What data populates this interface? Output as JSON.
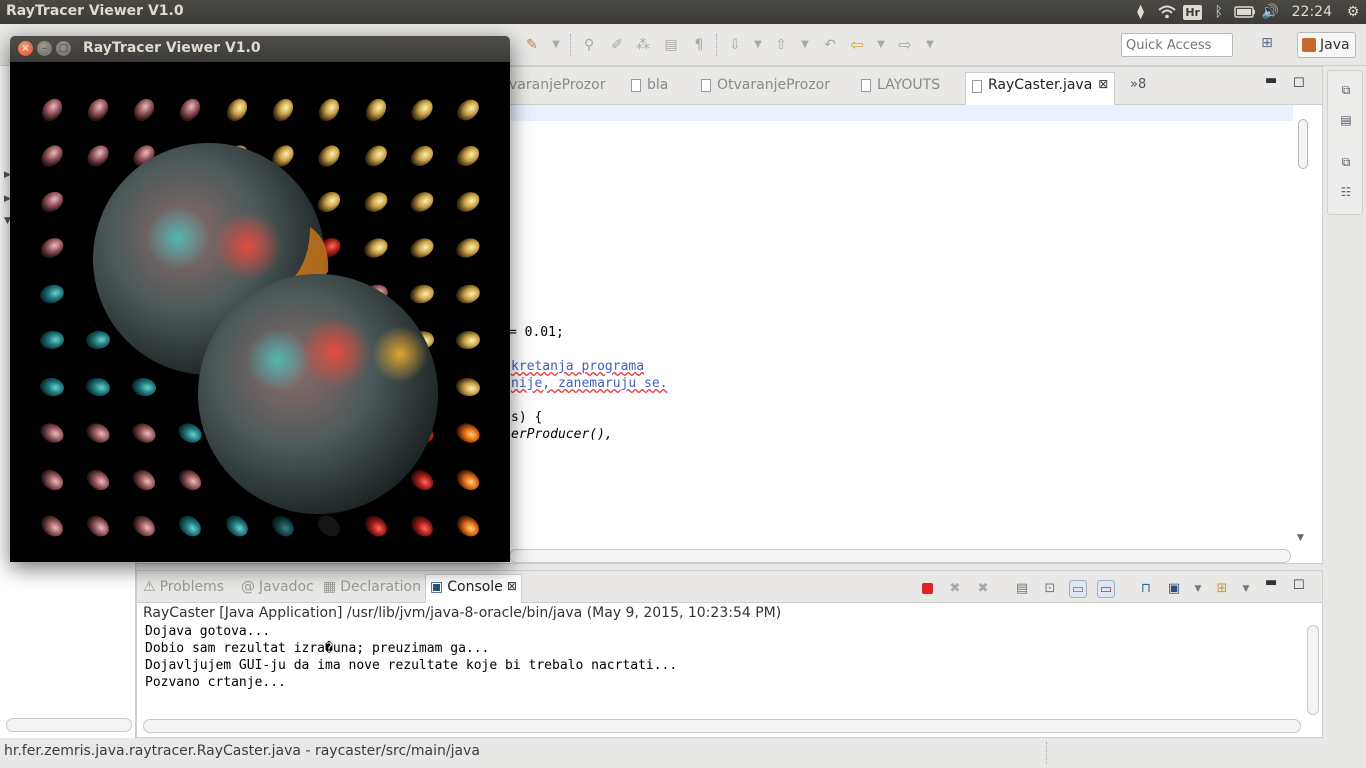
{
  "panel": {
    "app_title": "RayTracer Viewer V1.0",
    "keyboard_layout": "Hr",
    "clock": "22:24",
    "tray_icons": [
      "dropbox-icon",
      "wifi-icon",
      "keyboard-layout-indicator",
      "bluetooth-icon",
      "battery-icon",
      "volume-icon",
      "clock",
      "settings-gear-icon"
    ]
  },
  "toolbar": {
    "quick_access_placeholder": "Quick Access",
    "perspective_label": "Java",
    "icons": [
      "wand-icon",
      "pin-icon",
      "edit-icon",
      "block-selection-icon",
      "format-icon",
      "paragraph-icon",
      "next-annotation-icon",
      "prev-annotation-icon",
      "last-edit-icon",
      "back-icon",
      "forward-icon",
      "open-perspective-icon"
    ]
  },
  "editor": {
    "tabs": [
      {
        "label": "varanjeProzor",
        "active": false
      },
      {
        "label": "bla",
        "active": false
      },
      {
        "label": "OtvaranjeProzor",
        "active": false
      },
      {
        "label": "LAYOUTS",
        "active": false
      },
      {
        "label": "RayCaster.java",
        "active": true
      }
    ],
    "overflow_label": "»8",
    "code_lines": [
      {
        "text": "= 0.01;",
        "style": "code"
      },
      {
        "text": "kretanja programa",
        "style": "comment"
      },
      {
        "text": "nije, zanemaruju se.",
        "style": "comment"
      },
      {
        "text": "s) {",
        "style": "code"
      },
      {
        "text": "erProducer(),",
        "style": "italic"
      }
    ]
  },
  "console": {
    "tabs": [
      {
        "label": "Problems",
        "active": false
      },
      {
        "label": "Javadoc",
        "active": false
      },
      {
        "label": "Declaration",
        "active": false
      },
      {
        "label": "Console",
        "active": true
      }
    ],
    "description": "RayCaster [Java Application] /usr/lib/jvm/java-8-oracle/bin/java (May 9, 2015, 10:23:54 PM)",
    "output": [
      "Dojava gotova...",
      "Dobio sam rezultat izra�una; preuzimam ga...",
      "Dojavljujem GUI-ju da ima nove rezultate koje bi trebalo nacrtati...",
      "Pozvano crtanje..."
    ]
  },
  "status_bar": {
    "text": "hr.fer.zemris.java.raytracer.RayCaster.java - raycaster/src/main/java"
  },
  "raytracer_window": {
    "title": "RayTracer Viewer V1.0",
    "colors": {
      "background": "#000000",
      "teal": "#2c8a8c",
      "red": "#b8322c",
      "orange": "#e7801c",
      "yellow": "#e8c85a"
    }
  }
}
